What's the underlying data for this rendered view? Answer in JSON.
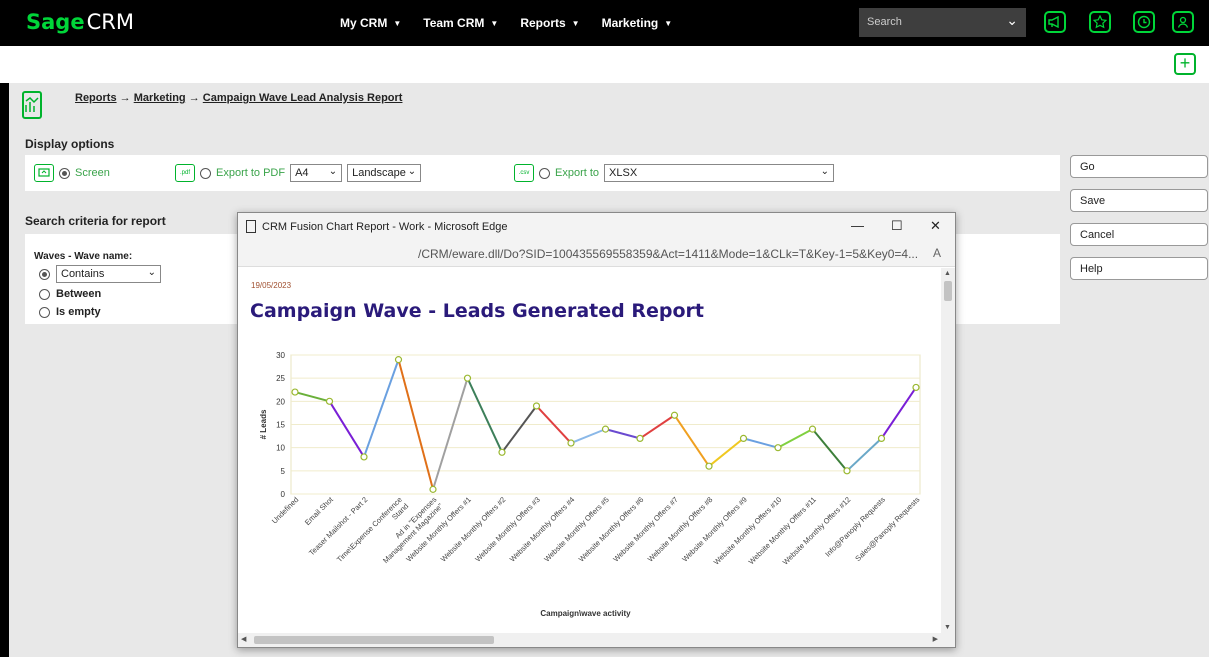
{
  "app": {
    "logo_main": "Sage",
    "logo_sub": "CRM"
  },
  "nav": [
    {
      "label": "My CRM"
    },
    {
      "label": "Team CRM"
    },
    {
      "label": "Reports"
    },
    {
      "label": "Marketing"
    }
  ],
  "search": {
    "placeholder": "Search"
  },
  "breadcrumb": {
    "reports": "Reports",
    "arrow": "→",
    "marketing": "Marketing",
    "current": "Campaign Wave Lead Analysis Report"
  },
  "display_options": {
    "title": "Display options",
    "screen_label": "Screen",
    "pdf_label": "Export to PDF",
    "pdf_size": "A4",
    "pdf_orientation": "Landscape",
    "export_label": "Export to",
    "export_format": "XLSX",
    "pdf_icon": ".pdf",
    "csv_icon": ".csv"
  },
  "search_criteria": {
    "title": "Search criteria for report",
    "field_label": "Waves - Wave name:",
    "contains": "Contains",
    "between": "Between",
    "is_empty": "Is empty"
  },
  "buttons": {
    "go": "Go",
    "save": "Save",
    "cancel": "Cancel",
    "help": "Help"
  },
  "edge": {
    "window_title": "CRM Fusion Chart Report - Work - Microsoft Edge",
    "url": "/CRM/eware.dll/Do?SID=100435569558359&Act=1411&Mode=1&CLk=T&Key-1=5&Key0=4...",
    "minimize": "—",
    "maximize": "☐",
    "close": "✕",
    "read_aloud": "A"
  },
  "report": {
    "date": "19/05/2023",
    "title": "Campaign Wave - Leads Generated Report"
  },
  "chart_data": {
    "type": "line",
    "xlabel": "Campaign\\wave activity",
    "ylabel": "# Leads",
    "ylim": [
      0,
      30
    ],
    "yticks": [
      0,
      5,
      10,
      15,
      20,
      25,
      30
    ],
    "categories": [
      "Undefined",
      "Email Shot",
      "Teaser Mailshot - Part 2",
      "Time\\Expense Conference Stand",
      "Ad in \"Expenses Management Magazine\"",
      "Website Monthly Offers #1",
      "Website Monthly Offers #2",
      "Website Monthly Offers #3",
      "Website Monthly Offers #4",
      "Website Monthly Offers #5",
      "Website Monthly Offers #6",
      "Website Monthly Offers #7",
      "Website Monthly Offers #8",
      "Website Monthly Offers #9",
      "Website Monthly Offers #10",
      "Website Monthly Offers #11",
      "Website Monthly Offers #12",
      "Info@Panoply Requests",
      "Sales@Panoply Requests"
    ],
    "values": [
      22,
      20,
      8,
      29,
      1,
      25,
      9,
      19,
      11,
      14,
      12,
      17,
      6,
      12,
      10,
      14,
      5,
      12,
      23
    ],
    "segment_colors": [
      "#6ab03a",
      "#7a1fd6",
      "#6aa0e0",
      "#e07018",
      "#a0a0a0",
      "#3d7f5a",
      "#555555",
      "#e04040",
      "#8ab8e8",
      "#6a4ad0",
      "#e04040",
      "#f0a020",
      "#f0c820",
      "#6aa0e0",
      "#80d040",
      "#3d7f3a",
      "#6aa8c8",
      "#7a1fd6"
    ]
  }
}
